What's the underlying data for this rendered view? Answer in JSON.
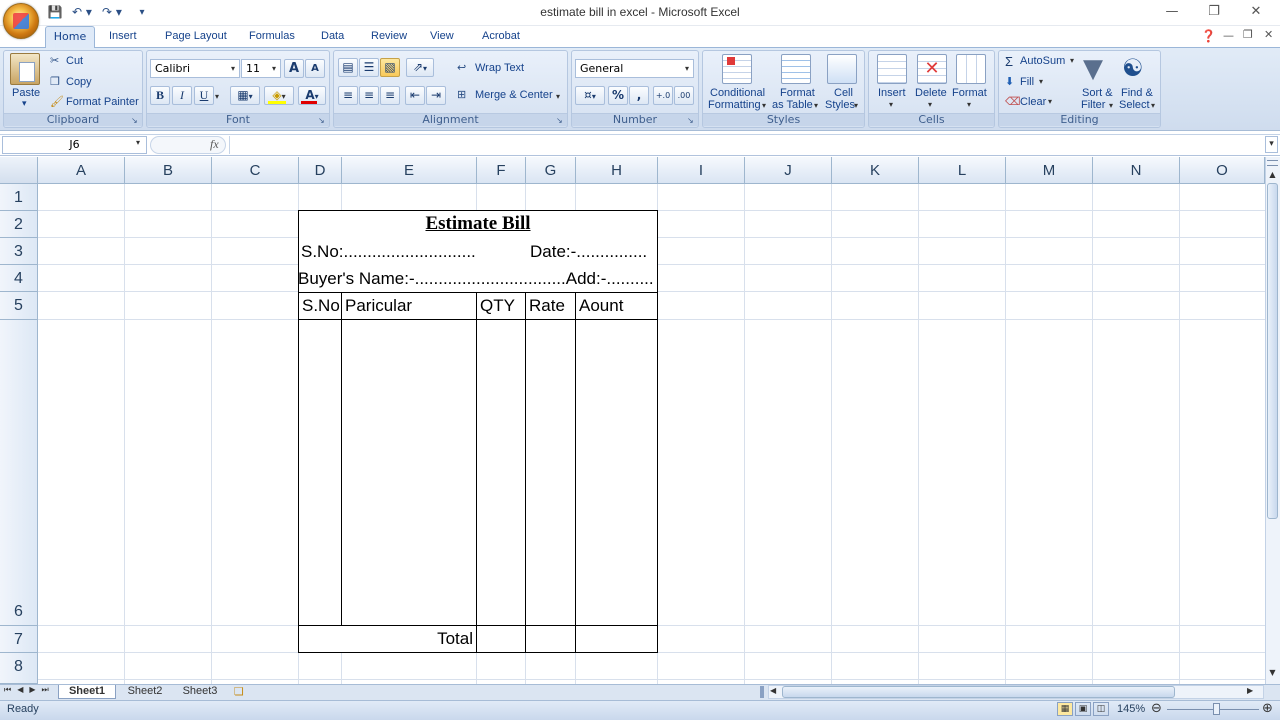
{
  "window": {
    "title": "estimate bill in excel - Microsoft Excel"
  },
  "ribbon_tabs": [
    "Home",
    "Insert",
    "Page Layout",
    "Formulas",
    "Data",
    "Review",
    "View",
    "Acrobat"
  ],
  "clipboard": {
    "paste": "Paste",
    "cut": "Cut",
    "copy": "Copy",
    "format_painter": "Format Painter",
    "label": "Clipboard"
  },
  "font": {
    "name": "Calibri",
    "size": "11",
    "bold": "B",
    "italic": "I",
    "underline": "U",
    "grow": "A",
    "shrink": "A",
    "color_a": "A",
    "label": "Font"
  },
  "alignment": {
    "wrap": "Wrap Text",
    "merge": "Merge & Center",
    "label": "Alignment"
  },
  "number": {
    "format": "General",
    "percent": "%",
    "comma": ",",
    "inc_dec": "+.0",
    "dec_dec": ".00",
    "label": "Number"
  },
  "styles": {
    "cond1": "Conditional",
    "cond2": "Formatting",
    "fmt1": "Format",
    "fmt2": "as Table",
    "cell1": "Cell",
    "cell2": "Styles",
    "label": "Styles"
  },
  "cells": {
    "insert": "Insert",
    "delete": "Delete",
    "format": "Format",
    "label": "Cells"
  },
  "editing": {
    "autosum": "AutoSum",
    "fill": "Fill",
    "clear": "Clear",
    "sort1": "Sort &",
    "sort2": "Filter",
    "find1": "Find &",
    "find2": "Select",
    "label": "Editing"
  },
  "formula_bar": {
    "name_box": "J6",
    "fx": "fx",
    "formula": ""
  },
  "columns": [
    "A",
    "B",
    "C",
    "D",
    "E",
    "F",
    "G",
    "H",
    "I",
    "J",
    "K",
    "L",
    "M",
    "N",
    "O"
  ],
  "rows": [
    "1",
    "2",
    "3",
    "4",
    "5",
    "6",
    "7",
    "8"
  ],
  "bill": {
    "title": "Estimate Bill",
    "sno_line": "S.No:............................",
    "date_line": "Date:-...............",
    "buyer_line": "Buyer's Name:-................................Add:-..........",
    "h_sno": "S.No",
    "h_particular": "Paricular",
    "h_qty": "QTY",
    "h_rate": "Rate",
    "h_amount": "Aount",
    "total": "Total"
  },
  "sheets": [
    "Sheet1",
    "Sheet2",
    "Sheet3"
  ],
  "status": {
    "mode": "Ready",
    "zoom": "145%"
  }
}
